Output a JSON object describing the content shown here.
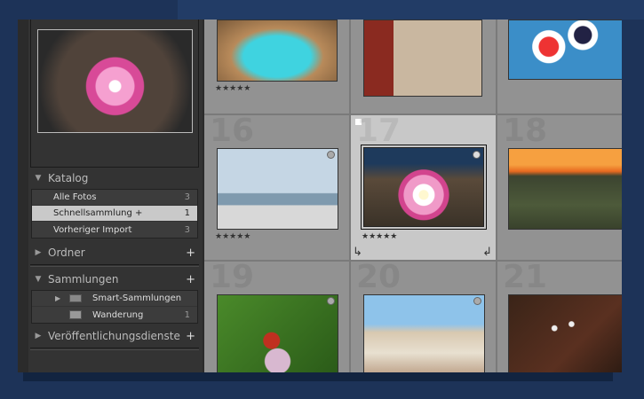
{
  "panel": {
    "katalog": {
      "title": "Katalog",
      "items": [
        {
          "label": "Alle Fotos",
          "count": "3"
        },
        {
          "label": "Schnellsammlung +",
          "count": "1"
        },
        {
          "label": "Vorheriger Import",
          "count": "3"
        }
      ]
    },
    "ordner": {
      "title": "Ordner"
    },
    "sammlungen": {
      "title": "Sammlungen",
      "items": [
        {
          "label": "Smart-Sammlungen",
          "count": ""
        },
        {
          "label": "Wanderung",
          "count": "1"
        }
      ]
    },
    "veroeffentlichung": {
      "title": "Veröffentlichungsdienste"
    },
    "plus": "+"
  },
  "grid": {
    "cells": [
      {
        "number": "",
        "stars": "★★★★★"
      },
      {
        "number": "",
        "stars": ""
      },
      {
        "number": "",
        "stars": ""
      },
      {
        "number": "16",
        "stars": "★★★★★"
      },
      {
        "number": "17",
        "stars": "★★★★★"
      },
      {
        "number": "18",
        "stars": ""
      },
      {
        "number": "19",
        "stars": ""
      },
      {
        "number": "20",
        "stars": ""
      },
      {
        "number": "21",
        "stars": ""
      }
    ],
    "selected_cell": "17"
  }
}
